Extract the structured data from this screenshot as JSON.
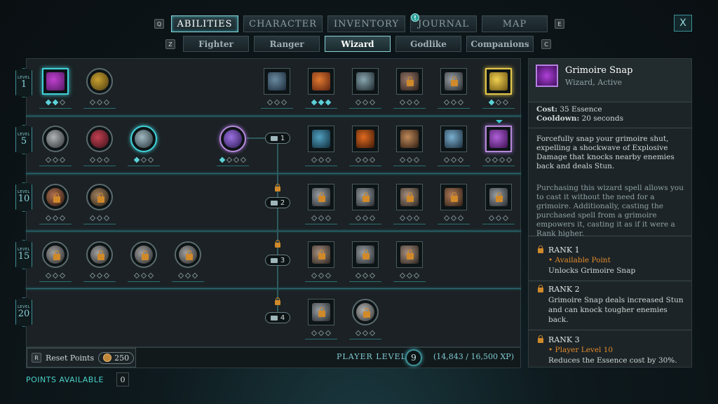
{
  "keys": {
    "prev_tab": "Q",
    "next_tab": "E",
    "prev_sub": "Z",
    "next_sub": "C",
    "reset": "R"
  },
  "main_tabs": [
    {
      "label": "ABILITIES",
      "active": true
    },
    {
      "label": "CHARACTER",
      "active": false
    },
    {
      "label": "INVENTORY",
      "active": false
    },
    {
      "label": "JOURNAL",
      "active": false
    },
    {
      "label": "MAP",
      "active": false
    }
  ],
  "journal_notification": "!",
  "close_label": "X",
  "sub_tabs": [
    {
      "label": "Fighter",
      "active": false
    },
    {
      "label": "Ranger",
      "active": false
    },
    {
      "label": "Wizard",
      "active": true
    },
    {
      "label": "Godlike",
      "active": false
    },
    {
      "label": "Companions",
      "active": false
    }
  ],
  "levels": [
    {
      "word": "LEVEL",
      "num": "1"
    },
    {
      "word": "LEVEL",
      "num": "5"
    },
    {
      "word": "LEVEL",
      "num": "10"
    },
    {
      "word": "LEVEL",
      "num": "15"
    },
    {
      "word": "LEVEL",
      "num": "20"
    }
  ],
  "grimoire_nodes": [
    "1",
    "2",
    "3",
    "4"
  ],
  "bottom": {
    "reset_label": "Reset Points",
    "reset_cost": "250",
    "player_level_label": "PLAYER LEVEL",
    "player_level": "9",
    "xp": "(14,843 / 16,500 XP)",
    "points_available_label": "POINTS AVAILABLE",
    "points_available": "0"
  },
  "detail": {
    "title": "Grimoire Snap",
    "subtitle": "Wizard, Active",
    "cost_label": "Cost:",
    "cost": "35 Essence",
    "cooldown_label": "Cooldown:",
    "cooldown": "20 seconds",
    "desc1": "Forcefully snap your grimoire shut, expelling a shockwave of Explosive Damage that knocks nearby enemies back and deals Stun.",
    "desc2": "Purchasing this wizard spell allows you to cast it without the need for a grimoire. Additionally, casting the purchased spell from a grimoire empowers it, casting it as if it were a Rank higher.",
    "ranks": [
      {
        "title": "RANK 1",
        "req": "• Available Point",
        "desc": "Unlocks Grimoire Snap"
      },
      {
        "title": "RANK 2",
        "req": "",
        "desc": "Grimoire Snap deals increased Stun and can knock tougher enemies back."
      },
      {
        "title": "RANK 3",
        "req": "• Player Level 10",
        "desc": "Reduces the Essence cost by 30%."
      }
    ]
  },
  "colors": {
    "accent": "#40c8d0",
    "lock": "#d08a2a",
    "selected": "#b680e0",
    "highlight": "#e6c84a"
  }
}
